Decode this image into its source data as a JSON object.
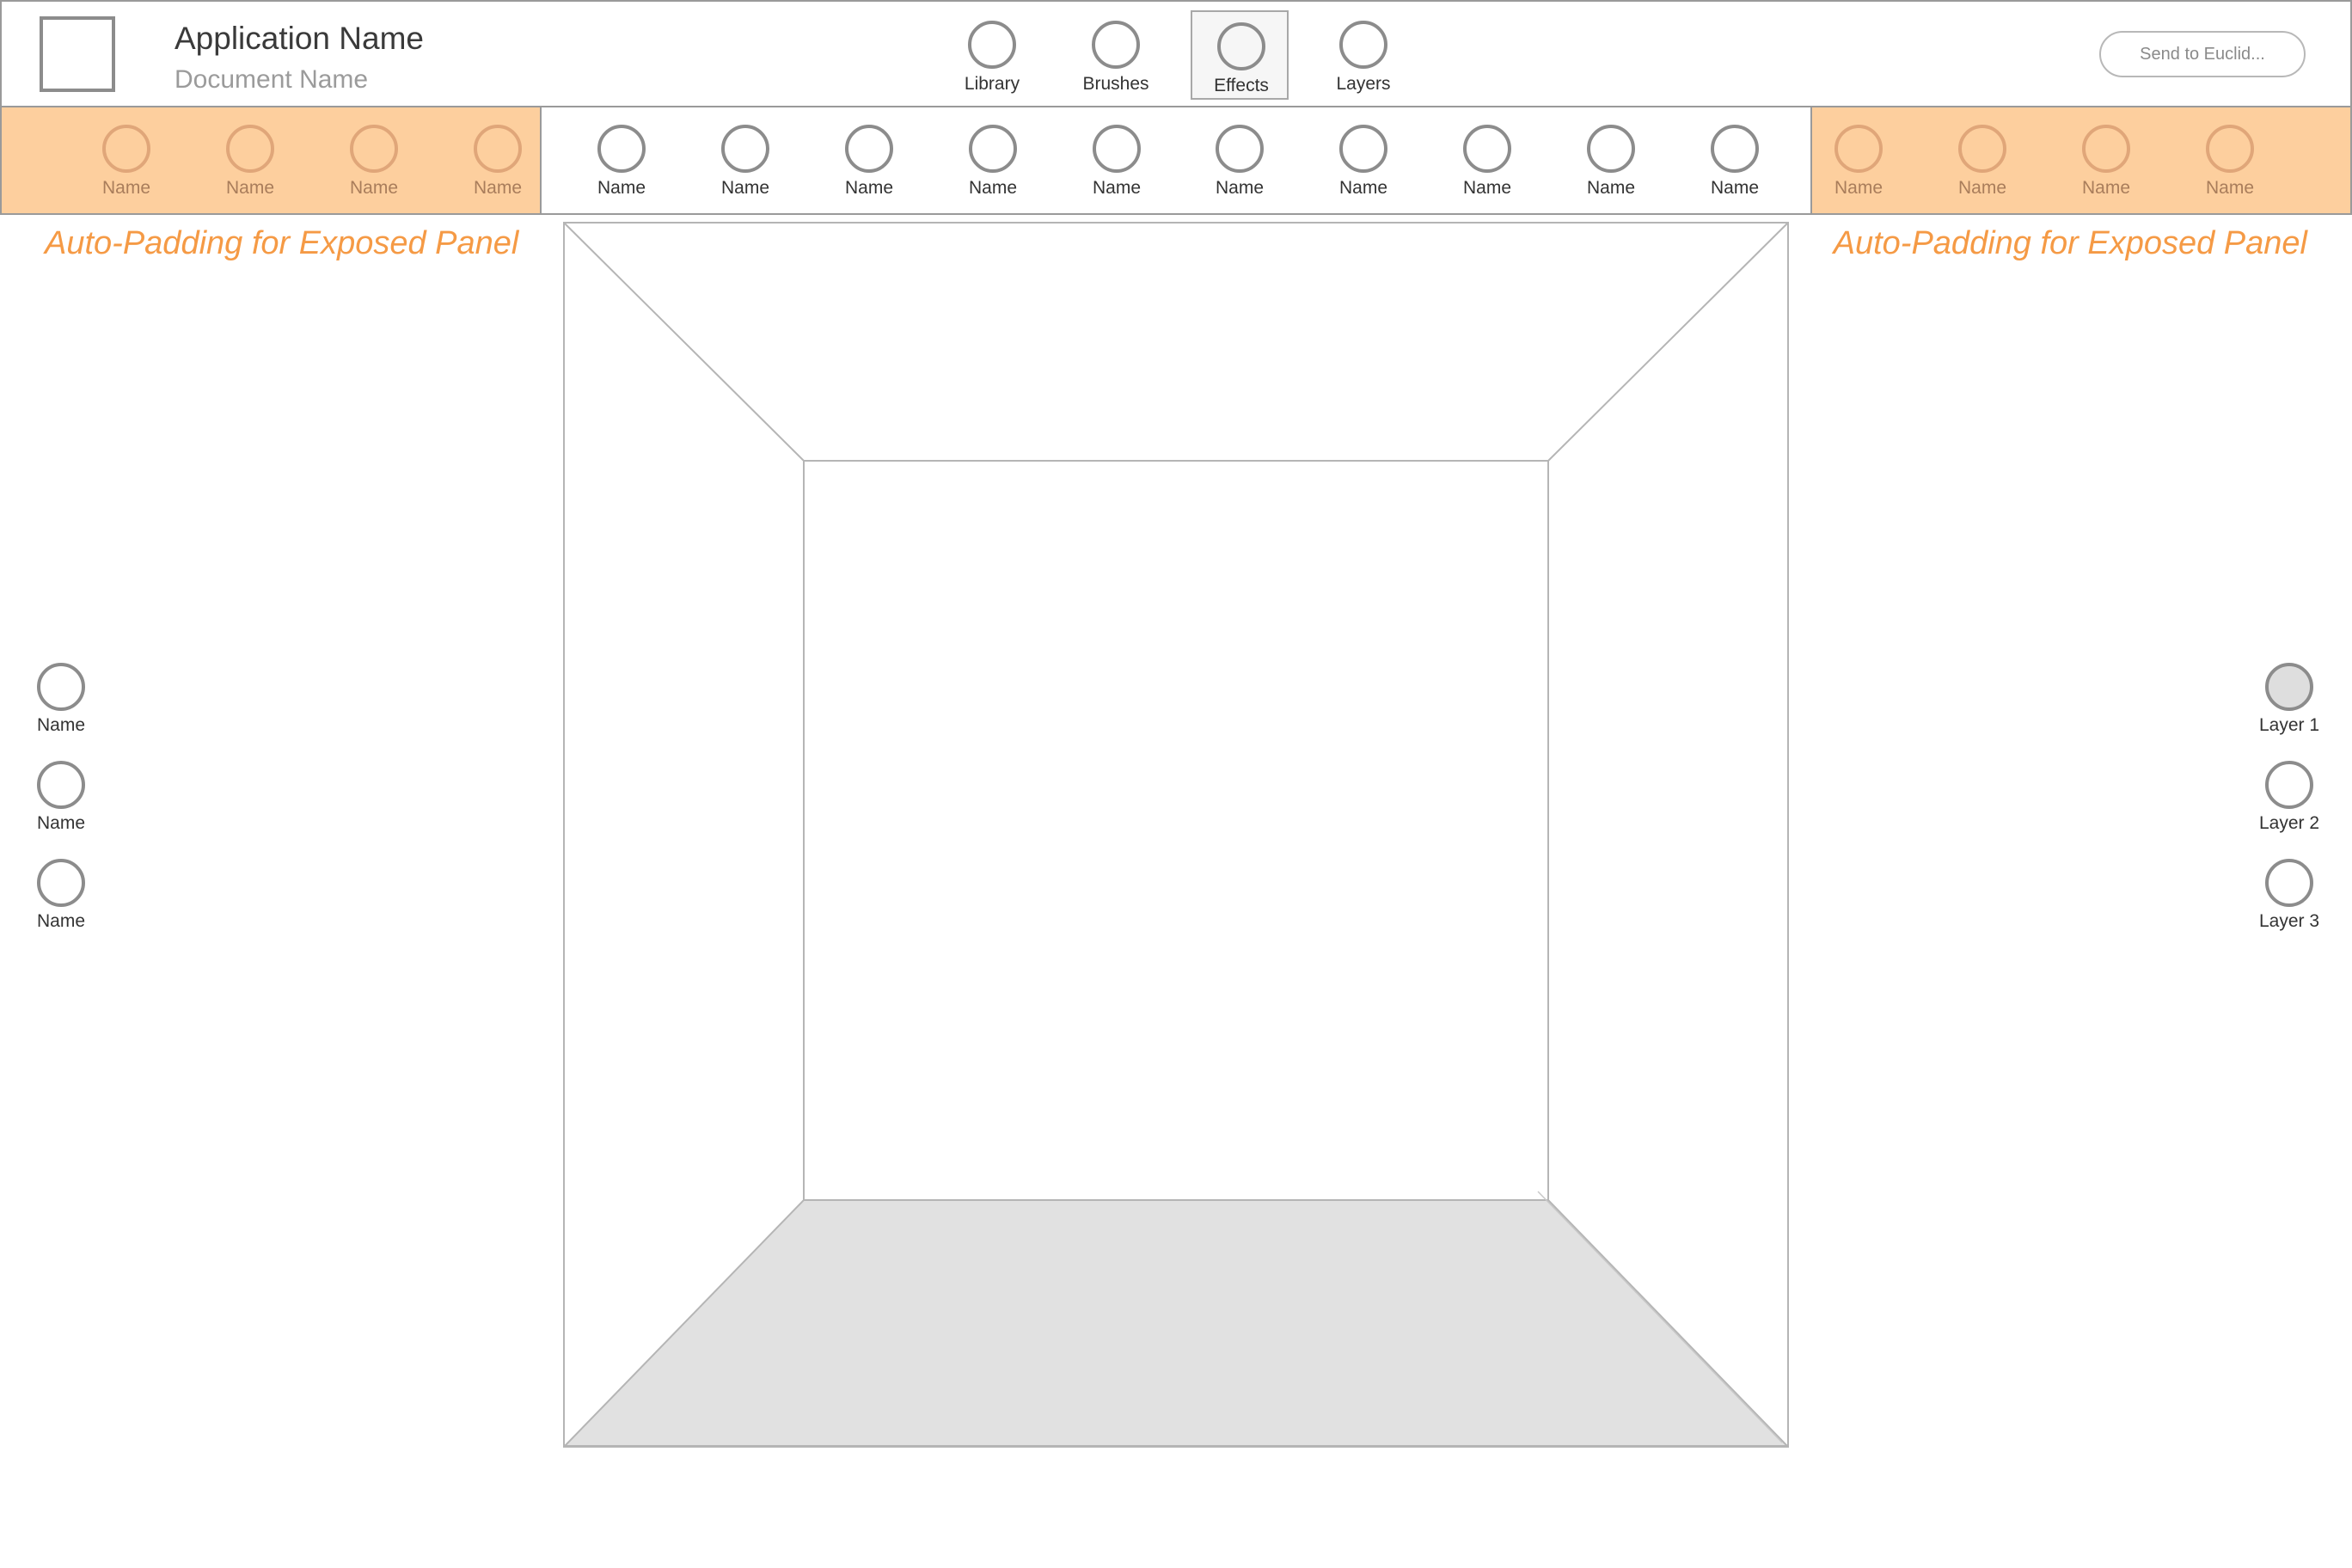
{
  "header": {
    "app_name": "Application Name",
    "document_name": "Document Name",
    "tabs": [
      {
        "label": "Library",
        "active": false
      },
      {
        "label": "Brushes",
        "active": false
      },
      {
        "label": "Effects",
        "active": true
      },
      {
        "label": "Layers",
        "active": false
      }
    ],
    "send_button": "Send to Euclid..."
  },
  "toolbar": {
    "left_tools": [
      {
        "label": "Name"
      },
      {
        "label": "Name"
      },
      {
        "label": "Name"
      },
      {
        "label": "Name"
      }
    ],
    "center_tools": [
      {
        "label": "Name"
      },
      {
        "label": "Name"
      },
      {
        "label": "Name"
      },
      {
        "label": "Name"
      },
      {
        "label": "Name"
      },
      {
        "label": "Name"
      },
      {
        "label": "Name"
      },
      {
        "label": "Name"
      },
      {
        "label": "Name"
      },
      {
        "label": "Name"
      }
    ],
    "right_tools": [
      {
        "label": "Name"
      },
      {
        "label": "Name"
      },
      {
        "label": "Name"
      },
      {
        "label": "Name"
      }
    ]
  },
  "padding_note_left": "Auto-Padding for Exposed Panel",
  "padding_note_right": "Auto-Padding for Exposed Panel",
  "left_panel": {
    "items": [
      {
        "label": "Name"
      },
      {
        "label": "Name"
      },
      {
        "label": "Name"
      }
    ]
  },
  "layers_panel": {
    "items": [
      {
        "label": "Layer 1",
        "selected": true
      },
      {
        "label": "Layer 2",
        "selected": false
      },
      {
        "label": "Layer 3",
        "selected": false
      }
    ]
  },
  "colors": {
    "accent_orange": "#fdcf9e",
    "note_orange": "#f59a45",
    "floor_gray": "#e1e1e1"
  }
}
